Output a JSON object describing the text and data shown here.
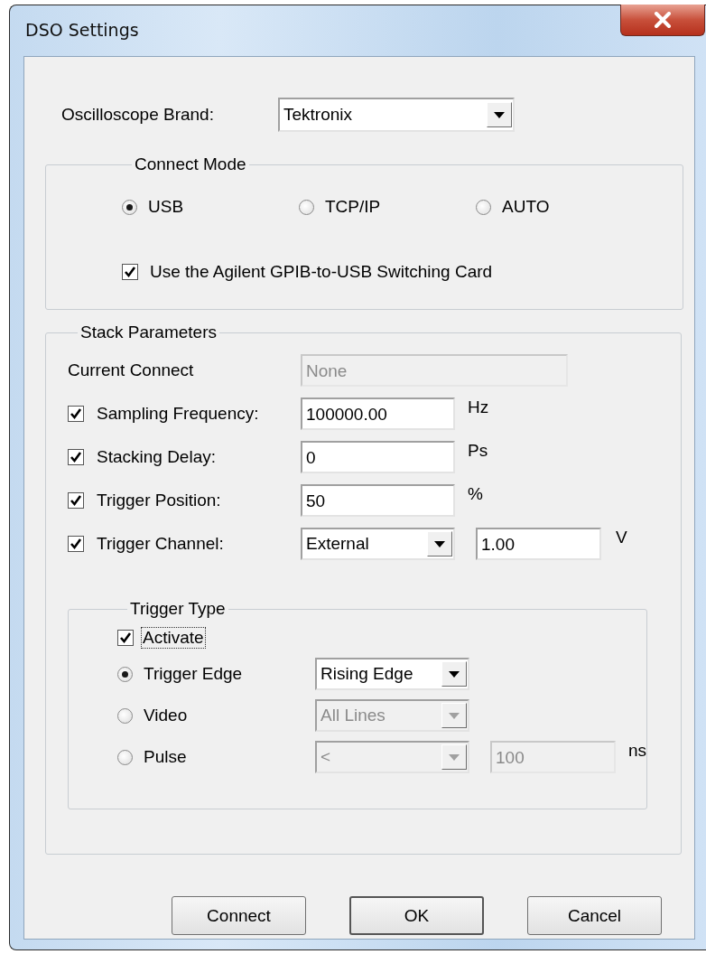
{
  "window": {
    "title": "DSO Settings"
  },
  "brand": {
    "label": "Oscilloscope Brand:",
    "value": "Tektronix"
  },
  "connect_mode": {
    "title": "Connect Mode",
    "options": [
      {
        "label": "USB",
        "selected": true
      },
      {
        "label": "TCP/IP",
        "selected": false
      },
      {
        "label": "AUTO",
        "selected": false
      }
    ],
    "switching_card": {
      "label": "Use the Agilent GPIB-to-USB Switching Card",
      "checked": true
    }
  },
  "stack_parameters": {
    "title": "Stack Parameters",
    "current_connect": {
      "label": "Current Connect",
      "value": "None",
      "disabled": true
    },
    "rows": [
      {
        "kind": "field",
        "label": "Sampling Frequency:",
        "checked": true,
        "value": "100000.00",
        "unit": "Hz"
      },
      {
        "kind": "field",
        "label": "Stacking Delay:",
        "checked": true,
        "value": "0",
        "unit": "Ps"
      },
      {
        "kind": "field",
        "label": "Trigger Position:",
        "checked": true,
        "value": "50",
        "unit": "%"
      },
      {
        "kind": "combo",
        "label": "Trigger Channel:",
        "checked": true,
        "value": "External",
        "level_value": "1.00",
        "unit": "V"
      }
    ],
    "trigger_type": {
      "title": "Trigger Type",
      "activate": {
        "label": "Activate",
        "checked": true,
        "focused": true
      },
      "options": [
        {
          "label": "Trigger Edge",
          "selected": true,
          "combo": {
            "value": "Rising Edge",
            "disabled": false
          }
        },
        {
          "label": "Video",
          "selected": false,
          "combo": {
            "value": "All Lines",
            "disabled": true
          }
        },
        {
          "label": "Pulse",
          "selected": false,
          "combo": {
            "value": "<",
            "disabled": true
          },
          "field": {
            "value": "100",
            "disabled": true
          },
          "unit": "ns"
        }
      ]
    }
  },
  "buttons": [
    {
      "label": "Connect",
      "default": false
    },
    {
      "label": "OK",
      "default": true
    },
    {
      "label": "Cancel",
      "default": false
    }
  ]
}
